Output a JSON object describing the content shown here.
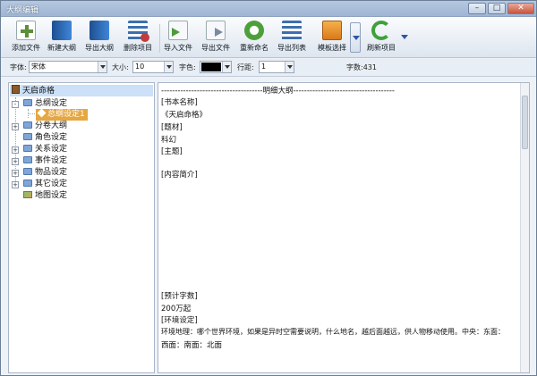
{
  "window": {
    "title": "大纲编辑",
    "minimize": "–",
    "maximize": "□",
    "close": "✕"
  },
  "toolbar": {
    "buttons": [
      {
        "label": "添加文件",
        "icon": "add-file-icon",
        "color": "#5e8e3a"
      },
      {
        "label": "新建大纲",
        "icon": "book-icon",
        "color": "#2f6fb7"
      },
      {
        "label": "导出大纲",
        "icon": "book-export-icon",
        "color": "#2f6fb7"
      },
      {
        "label": "删除项目",
        "icon": "delete-list-icon",
        "color": "#c23b3b"
      },
      {
        "label": "导入文件",
        "icon": "import-file-icon",
        "color": "#4e9b3a"
      },
      {
        "label": "导出文件",
        "icon": "export-file-icon",
        "color": "#7a8aa0"
      },
      {
        "label": "重新命名",
        "icon": "rename-icon",
        "color": "#4ca03a"
      },
      {
        "label": "导出列表",
        "icon": "list-export-icon",
        "color": "#3c6fb0"
      },
      {
        "label": "模板选择",
        "icon": "template-icon",
        "color": "#e08a1e"
      },
      {
        "label": "刷新项目",
        "icon": "refresh-icon",
        "color": "#3fa13a"
      }
    ]
  },
  "format": {
    "font_label": "字体:",
    "font_value": "宋体",
    "size_label": "大小:",
    "size_value": "10",
    "color_label": "字色:",
    "color_value": "#000000",
    "spacing_label": "行距:",
    "spacing_value": "1",
    "word_count": "字数:431"
  },
  "tree": {
    "root": "天启命格",
    "items": [
      {
        "label": "总纲设定",
        "expander": "-"
      },
      {
        "label": "总纲设定1",
        "expander": ""
      },
      {
        "label": "分卷大纲",
        "expander": "+"
      },
      {
        "label": "角色设定",
        "expander": ""
      },
      {
        "label": "关系设定",
        "expander": "+"
      },
      {
        "label": "事件设定",
        "expander": "+"
      },
      {
        "label": "物品设定",
        "expander": "+"
      },
      {
        "label": "其它设定",
        "expander": "+"
      },
      {
        "label": "地图设定",
        "expander": ""
      }
    ]
  },
  "editor": {
    "lines": [
      "-------------------------------------明细大纲-------------------------------------",
      "[书本名称]",
      "   《天启命格》",
      "[题材]",
      "      科幻",
      "[主题]",
      "[内容简介]",
      "[预计字数]",
      "      200万起",
      "[环境设定]",
      " 环境地理：哪个世界环境，如果是异时空需要说明，什么地名，越后面越远，供人物移动使用。中央：东面：",
      "西面：南面：北面"
    ]
  },
  "colors": {
    "selected": "#cce0f7",
    "accent": "#2e56a7"
  }
}
